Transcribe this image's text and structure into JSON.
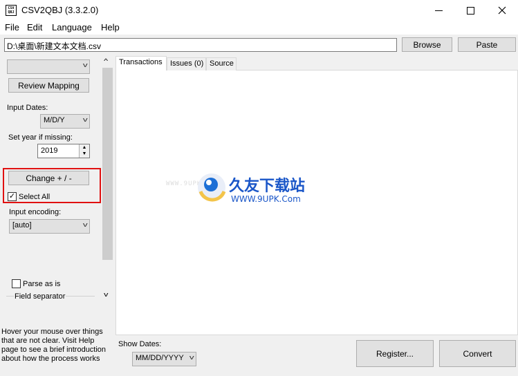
{
  "window": {
    "icon_text": "CSV QBJ",
    "title": "CSV2QBJ (3.3.2.0)"
  },
  "menu": [
    "File",
    "Edit",
    "Language",
    "Help"
  ],
  "file_path": "D:\\桌面\\新建文本文档.csv",
  "buttons": {
    "browse": "Browse",
    "paste": "Paste",
    "review_mapping": "Review Mapping",
    "change": "Change + / -",
    "register": "Register...",
    "convert": "Convert"
  },
  "left": {
    "mapping_selected": "",
    "input_dates_label": "Input Dates:",
    "input_dates_value": "M/D/Y",
    "year_label": "Set year if missing:",
    "year_value": "2019",
    "select_all_label": "Select All",
    "select_all_checked": true,
    "encoding_label": "Input encoding:",
    "encoding_value": "[auto]",
    "parse_as_is_label": "Parse as is",
    "parse_as_is_checked": false,
    "field_separator_label": "Field separator"
  },
  "help_text": "Hover your mouse over things that are not clear. Visit Help page to see a brief introduction about how the process works",
  "tabs": [
    "Transactions",
    "Issues (0)",
    "Source"
  ],
  "active_tab": 0,
  "show_dates_label": "Show Dates:",
  "show_dates_value": "MM/DD/YYYY",
  "watermark": {
    "left_text": "WWW.9UPK.COM",
    "brand": "久友下载站",
    "url": "WWW.9UPK.Com"
  },
  "colors": {
    "highlight": "#e01010",
    "button_bg": "#e1e1e1"
  }
}
